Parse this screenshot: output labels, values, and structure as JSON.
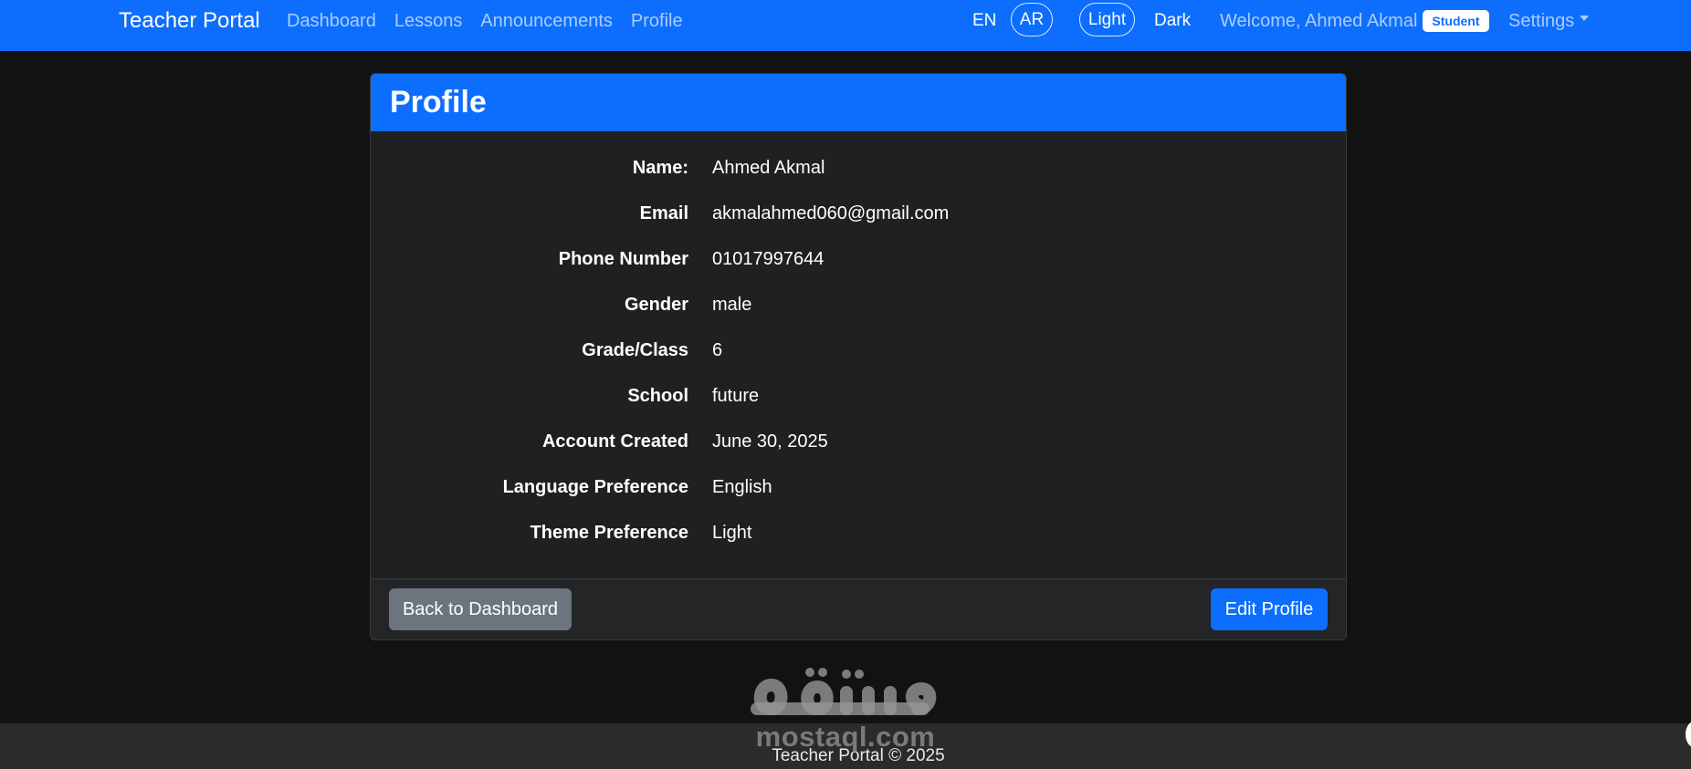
{
  "navbar": {
    "brand": "Teacher Portal",
    "links": [
      "Dashboard",
      "Lessons",
      "Announcements",
      "Profile"
    ],
    "lang_en": "EN",
    "lang_ar": "AR",
    "theme_light": "Light",
    "theme_dark": "Dark",
    "welcome": "Welcome, Ahmed Akmal",
    "role_badge": "Student",
    "settings": "Settings"
  },
  "profile": {
    "title": "Profile",
    "fields": [
      {
        "label": "Name:",
        "value": "Ahmed Akmal"
      },
      {
        "label": "Email",
        "value": "akmalahmed060@gmail.com"
      },
      {
        "label": "Phone Number",
        "value": "01017997644"
      },
      {
        "label": "Gender",
        "value": "male"
      },
      {
        "label": "Grade/Class",
        "value": "6"
      },
      {
        "label": "School",
        "value": "future"
      },
      {
        "label": "Account Created",
        "value": "June 30, 2025"
      },
      {
        "label": "Language Preference",
        "value": "English"
      },
      {
        "label": "Theme Preference",
        "value": "Light"
      }
    ],
    "back_button": "Back to Dashboard",
    "edit_button": "Edit Profile"
  },
  "footer": {
    "text": "Teacher Portal © 2025"
  },
  "watermark": {
    "arabic": "مستقل",
    "latin": "mostaql.com"
  },
  "colors": {
    "primary": "#0d6efd",
    "secondary": "#6c757d",
    "background": "#121212",
    "card": "#1f2022"
  }
}
